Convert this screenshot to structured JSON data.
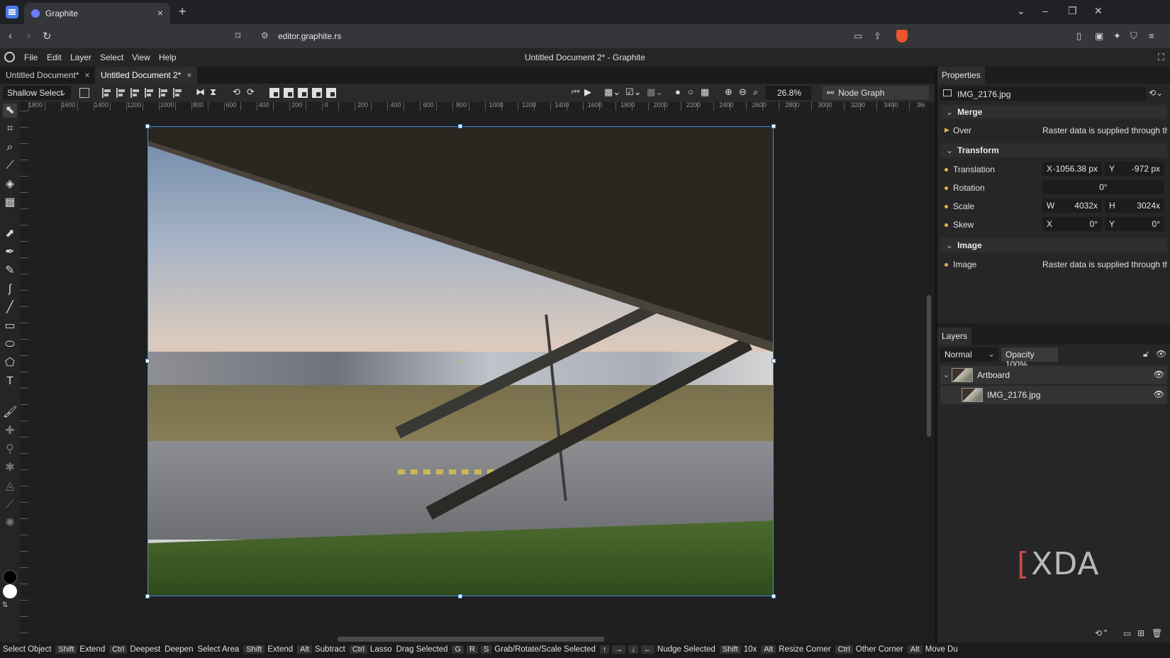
{
  "browser": {
    "tab_title": "Graphite",
    "tab_close": "×",
    "new_tab": "+",
    "url": "editor.graphite.rs",
    "controls": {
      "tabs_menu": "⌄",
      "minimize": "–",
      "restore": "❐",
      "close": "✕"
    }
  },
  "app": {
    "menu": [
      "File",
      "Edit",
      "Layer",
      "Select",
      "View",
      "Help"
    ],
    "window_title": "Untitled Document 2* - Graphite"
  },
  "doc_tabs": [
    {
      "label": "Untitled Document*",
      "close": "×",
      "active": false
    },
    {
      "label": "Untitled Document 2*",
      "close": "×",
      "active": true
    }
  ],
  "options_bar": {
    "select_mode": "Shallow Select",
    "zoom": "26.8%",
    "node_graph_label": "Node Graph"
  },
  "ruler": {
    "horizontal": [
      "1800",
      "1600",
      "1400",
      "1200",
      "1000",
      "800",
      "600",
      "400",
      "200",
      "0",
      "200",
      "400",
      "600",
      "800",
      "1000",
      "1200",
      "1400",
      "1600",
      "1800",
      "2000",
      "2200",
      "2400",
      "2600",
      "2800",
      "3000",
      "3200",
      "3400",
      "3600"
    ]
  },
  "properties": {
    "tab": "Properties",
    "layer_name": "IMG_2176.jpg",
    "merge": {
      "title": "Merge",
      "over_label": "Over",
      "over_value": "Raster data is supplied through the"
    },
    "transform": {
      "title": "Transform",
      "translation_label": "Translation",
      "translation_x_label": "X",
      "translation_x": "-1056.38 px",
      "translation_y_label": "Y",
      "translation_y": "-972 px",
      "rotation_label": "Rotation",
      "rotation": "0°",
      "scale_label": "Scale",
      "scale_w_label": "W",
      "scale_w": "4032x",
      "scale_h_label": "H",
      "scale_h": "3024x",
      "skew_label": "Skew",
      "skew_x_label": "X",
      "skew_x": "0°",
      "skew_y_label": "Y",
      "skew_y": "0°"
    },
    "image": {
      "title": "Image",
      "image_label": "Image",
      "image_value": "Raster data is supplied through the"
    }
  },
  "layers": {
    "tab": "Layers",
    "blend_mode": "Normal",
    "opacity_label": "Opacity",
    "opacity": "100%",
    "opacity_fraction": 1.0,
    "items": [
      {
        "name": "Artboard",
        "expanded": true
      },
      {
        "name": "IMG_2176.jpg"
      }
    ]
  },
  "watermark": "XDA",
  "status_bar": [
    {
      "keys": [],
      "label": "Select Object"
    },
    {
      "keys": [
        "Shift"
      ],
      "label": "Extend"
    },
    {
      "keys": [
        "Ctrl"
      ],
      "label": "Deepest"
    },
    {
      "keys": [],
      "label": "Deepen"
    },
    {
      "keys": [],
      "label": "Select Area"
    },
    {
      "keys": [
        "Shift"
      ],
      "label": "Extend"
    },
    {
      "keys": [
        "Alt"
      ],
      "label": "Subtract"
    },
    {
      "keys": [
        "Ctrl"
      ],
      "label": "Lasso"
    },
    {
      "keys": [],
      "label": "Drag Selected"
    },
    {
      "keys": [
        "G",
        "R",
        "S"
      ],
      "label": "Grab/Rotate/Scale Selected"
    },
    {
      "keys": [
        "↑",
        "→",
        "↓",
        "←"
      ],
      "label": "Nudge Selected"
    },
    {
      "keys": [
        "Shift"
      ],
      "label": "10x"
    },
    {
      "keys": [
        "Alt"
      ],
      "label": "Resize Corner"
    },
    {
      "keys": [
        "Ctrl"
      ],
      "label": "Other Corner"
    },
    {
      "keys": [
        "Alt"
      ],
      "label": "Move Du"
    }
  ],
  "colors": {
    "accent": "#3d8ee0",
    "dot": "#e6b04a",
    "primary_color": "#000000",
    "secondary_color": "#ffffff"
  }
}
